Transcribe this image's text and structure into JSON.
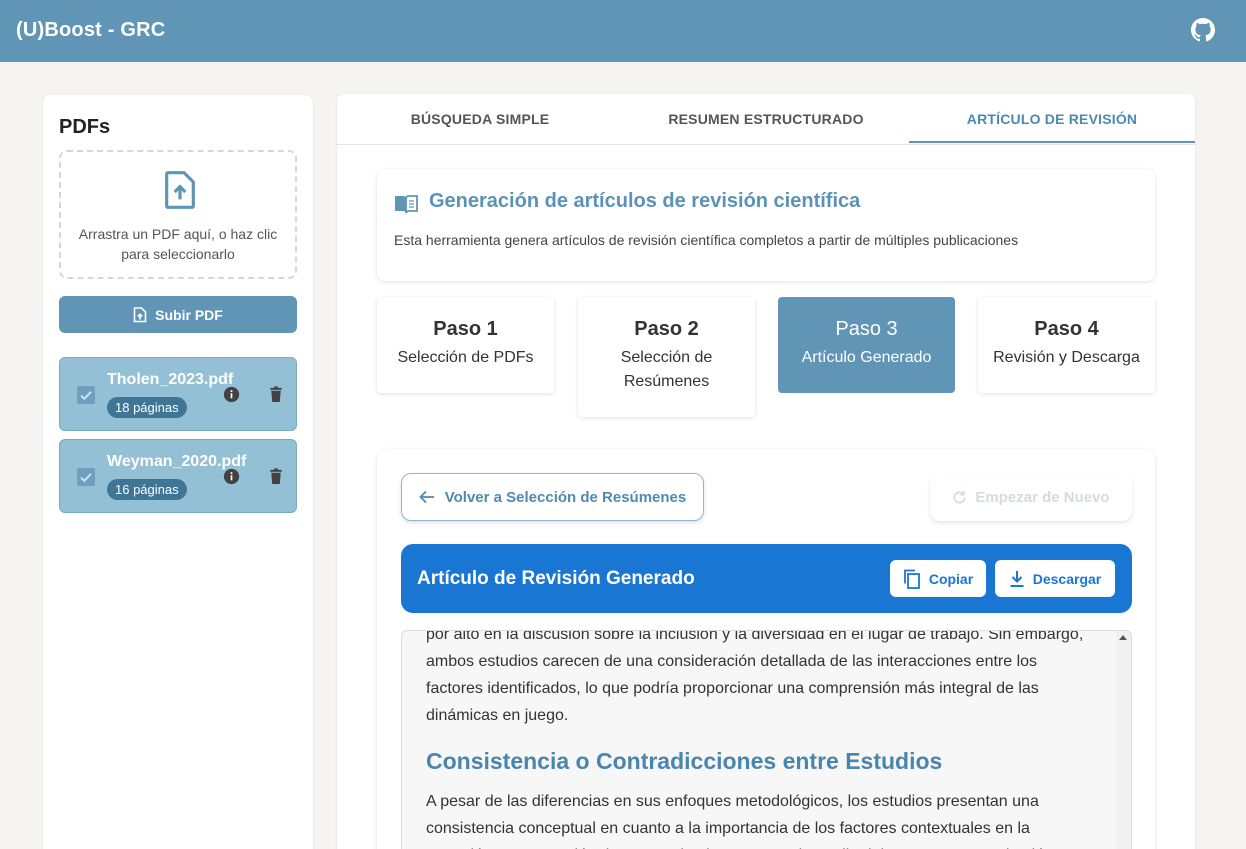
{
  "app": {
    "title": "(U)Boost - GRC"
  },
  "sidebar": {
    "heading": "PDFs",
    "dropzone_text": "Arrastra un PDF aquí, o haz clic para seleccionarlo",
    "upload_label": "Subir PDF",
    "files": [
      {
        "name": "Tholen_2023.pdf",
        "pages": "18 páginas"
      },
      {
        "name": "Weyman_2020.pdf",
        "pages": "16 páginas"
      }
    ]
  },
  "tabs": [
    "BÚSQUEDA SIMPLE",
    "RESUMEN ESTRUCTURADO",
    "ARTÍCULO DE REVISIÓN"
  ],
  "active_tab": 2,
  "intro": {
    "title": "Generación de artículos de revisión científica",
    "description": "Esta herramienta genera artículos de revisión científica completos a partir de múltiples publicaciones"
  },
  "steps": [
    {
      "number": "Paso 1",
      "label": "Selección de PDFs"
    },
    {
      "number": "Paso 2",
      "label": "Selección de Resúmenes"
    },
    {
      "number": "Paso 3",
      "label": "Artículo Generado"
    },
    {
      "number": "Paso 4",
      "label": "Revisión y Descarga"
    }
  ],
  "active_step": 2,
  "panel": {
    "back_label": "Volver a Selección de Resúmenes",
    "restart_label": "Empezar de Nuevo",
    "header_title": "Artículo de Revisión Generado",
    "copy_label": "Copiar",
    "download_label": "Descargar",
    "para1": "por alto en la discusión sobre la inclusión y la diversidad en el lugar de trabajo. Sin embargo, ambos estudios carecen de una consideración detallada de las interacciones entre los factores identificados, lo que podría proporcionar una comprensión más integral de las dinámicas en juego.",
    "heading2": "Consistencia o Contradicciones entre Estudios",
    "para2": "A pesar de las diferencias en sus enfoques metodológicos, los estudios presentan una consistencia conceptual en cuanto a la importancia de los factores contextuales en la retención y contratación de personal. Mientras que el estudio del NHS muestra cohesión"
  },
  "colors": {
    "appbar": "#6095b6",
    "accent": "#1976d2",
    "heading": "#4a85ae"
  }
}
